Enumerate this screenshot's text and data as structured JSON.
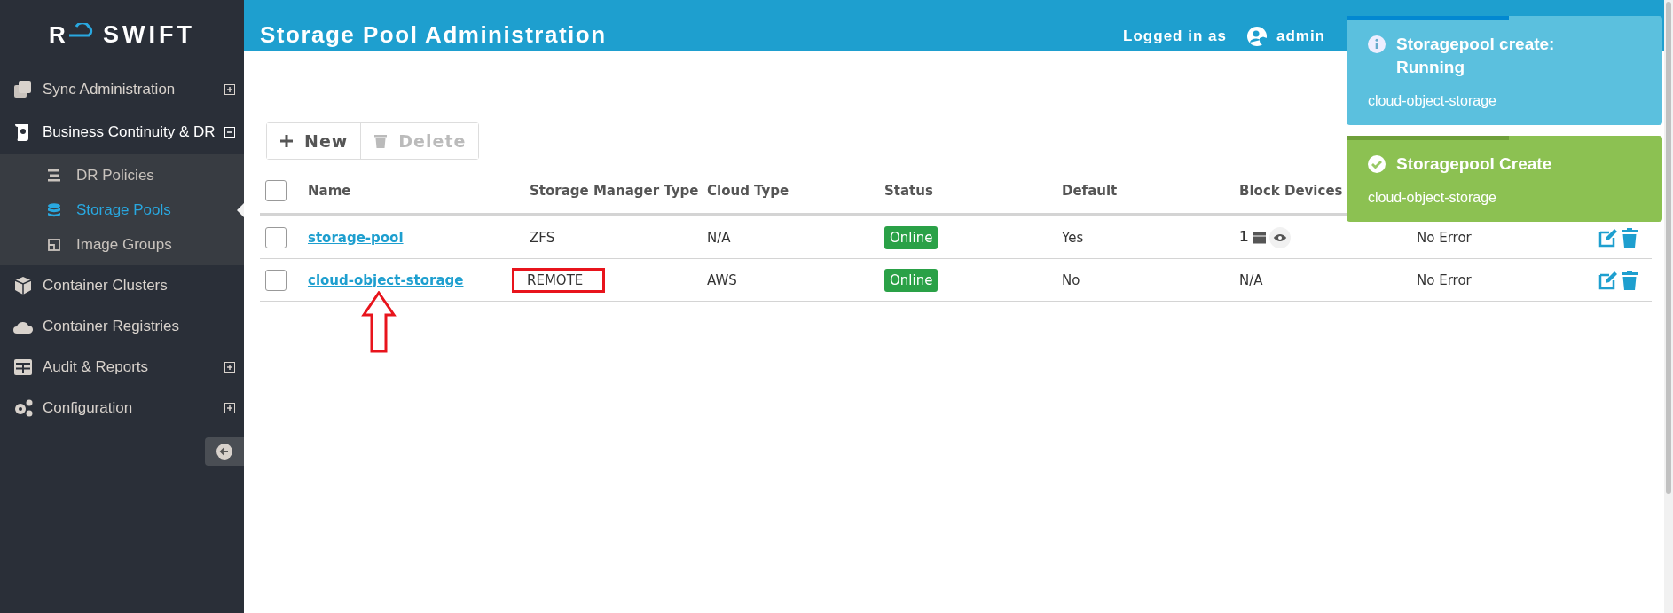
{
  "sidebar": {
    "logo": {
      "letter": "R",
      "text": "SWIFT"
    },
    "items": [
      {
        "label": "Sync Administration",
        "has_toggle": true,
        "expanded": false
      },
      {
        "label": "Business Continuity & DR",
        "has_toggle": true,
        "expanded": true,
        "children": [
          {
            "label": "DR Policies",
            "selected": false
          },
          {
            "label": "Storage Pools",
            "selected": true
          },
          {
            "label": "Image Groups",
            "selected": false
          }
        ]
      },
      {
        "label": "Container Clusters",
        "has_toggle": false,
        "expanded": false
      },
      {
        "label": "Container Registries",
        "has_toggle": false,
        "expanded": false
      },
      {
        "label": "Audit & Reports",
        "has_toggle": true,
        "expanded": false
      },
      {
        "label": "Configuration",
        "has_toggle": true,
        "expanded": false
      }
    ]
  },
  "header": {
    "title": "Storage Pool Administration",
    "logged_in_label": "Logged in as",
    "user": "admin"
  },
  "toolbar": {
    "buttons": [
      {
        "label": "New",
        "disabled": false
      },
      {
        "label": "Delete",
        "disabled": true
      }
    ]
  },
  "table": {
    "all_selected": false,
    "columns": [
      "Name",
      "Storage Manager Type",
      "Cloud Type",
      "Status",
      "Default",
      "Block Devices"
    ],
    "rows": [
      {
        "selected": false,
        "name": "storage-pool",
        "manager": "ZFS",
        "cloud": "N/A",
        "status": "Online",
        "default": "Yes",
        "block_devices": {
          "kind": "count",
          "text": "1"
        },
        "error": "No Error",
        "highlighted": false,
        "arrow": false
      },
      {
        "selected": false,
        "name": "cloud-object-storage",
        "manager": "REMOTE",
        "cloud": "AWS",
        "status": "Online",
        "default": "No",
        "block_devices": {
          "kind": "text",
          "text": "N/A"
        },
        "error": "No Error",
        "highlighted": true,
        "arrow": true
      }
    ]
  },
  "toasts": [
    {
      "kind": "info",
      "title": "Storagepool create: Running",
      "body": "cloud-object-storage"
    },
    {
      "kind": "success",
      "title": "Storagepool Create",
      "body": "cloud-object-storage"
    }
  ]
}
